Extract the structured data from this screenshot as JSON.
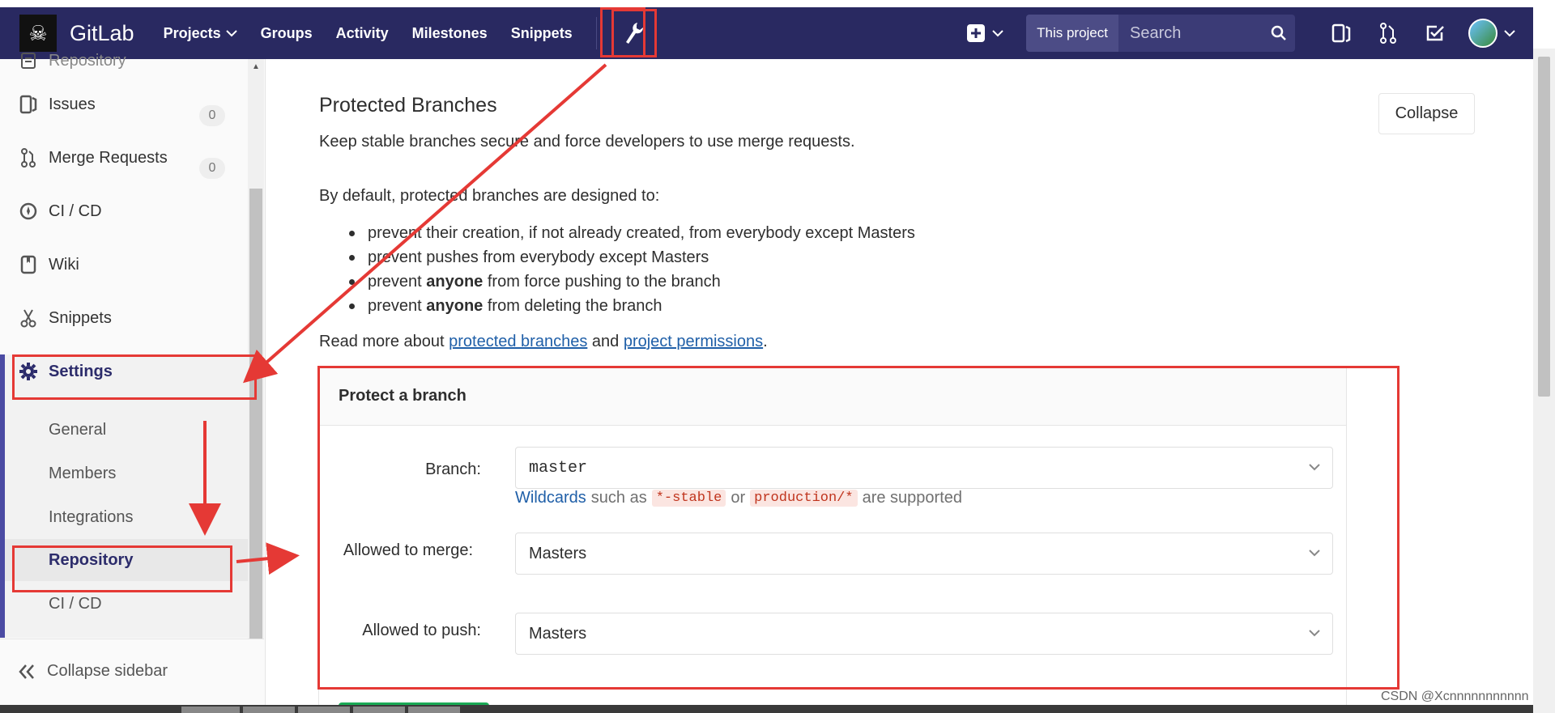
{
  "topnav": {
    "brand": "GitLab",
    "items": [
      {
        "label": "Projects",
        "has_dropdown": true
      },
      {
        "label": "Groups"
      },
      {
        "label": "Activity"
      },
      {
        "label": "Milestones"
      },
      {
        "label": "Snippets"
      }
    ],
    "search": {
      "scope": "This project",
      "placeholder": "Search"
    }
  },
  "sidebar": {
    "items": [
      {
        "label": "Repository",
        "icon": "book-icon"
      },
      {
        "label": "Issues",
        "icon": "issues-icon",
        "badge": "0"
      },
      {
        "label": "Merge Requests",
        "icon": "merge-request-icon",
        "badge": "0"
      },
      {
        "label": "CI / CD",
        "icon": "rocket-icon"
      },
      {
        "label": "Wiki",
        "icon": "wiki-icon"
      },
      {
        "label": "Snippets",
        "icon": "scissors-icon"
      },
      {
        "label": "Settings",
        "icon": "gear-icon"
      }
    ],
    "settings_sub": [
      "General",
      "Members",
      "Integrations",
      "Repository",
      "CI / CD"
    ],
    "collapse_label": "Collapse sidebar"
  },
  "main": {
    "title": "Protected Branches",
    "collapse_label": "Collapse",
    "intro": "Keep stable branches secure and force developers to use merge requests.",
    "default_text": "By default, protected branches are designed to:",
    "bullets": [
      {
        "pre": "prevent their creation, if not already created, from everybody except Masters",
        "bold": "",
        "post": ""
      },
      {
        "pre": "prevent pushes from everybody except Masters",
        "bold": "",
        "post": ""
      },
      {
        "pre": "prevent ",
        "bold": "anyone",
        "post": " from force pushing to the branch"
      },
      {
        "pre": "prevent ",
        "bold": "anyone",
        "post": " from deleting the branch"
      }
    ],
    "read_more": {
      "pre": "Read more about ",
      "link1": "protected branches",
      "mid": " and ",
      "link2": "project permissions",
      "post": "."
    },
    "panel": {
      "title": "Protect a branch",
      "branch_label": "Branch:",
      "branch_value": "master",
      "hint": {
        "wild": "Wildcards",
        "t1": "such as",
        "code1": "*-stable",
        "t2": "or",
        "code2": "production/*",
        "t3": "are supported"
      },
      "merge_label": "Allowed to merge:",
      "merge_value": "Masters",
      "push_label": "Allowed to push:",
      "push_value": "Masters"
    }
  },
  "watermark": "CSDN @Xcnnnnnnnnnnn",
  "colors": {
    "nav": "#292961",
    "accent": "#4b4ba3",
    "annotation": "#e53935",
    "link": "#1f5fa8"
  }
}
